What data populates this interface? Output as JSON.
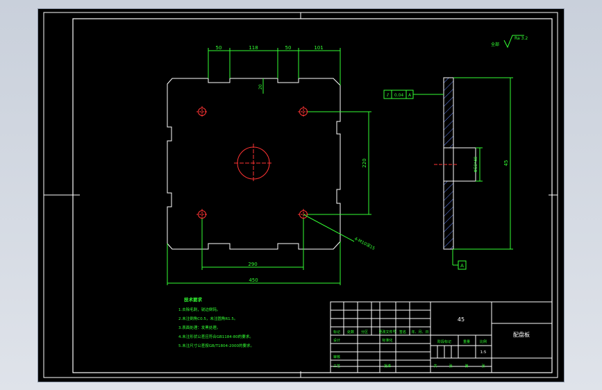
{
  "drawing": {
    "part_name": "配盘板",
    "material": "45",
    "scale": "1:5",
    "roughness_prefix": "全部",
    "roughness_value": "Ra 3.2"
  },
  "dimensions": {
    "top_widths": [
      "50",
      "118",
      "50",
      "101"
    ],
    "notch_depth": "20",
    "hole_spacing_vertical": "220",
    "hole_spacing_horizontal": "290",
    "overall_width": "450",
    "hole_callout": "4-M10深15",
    "section_height": "45",
    "section_bore": "Φ50*40"
  },
  "tolerance_frame": {
    "symbol": "⫽",
    "value": "0.04",
    "datum": "A"
  },
  "datum_label": "A",
  "tech_notes": {
    "title": "技术要求",
    "items": [
      "1.去除毛刺，锐边倒钝。",
      "2.未注倒角C0.5，未注圆角R1.5。",
      "3.表面处理：发黑处理。",
      "4.未注形状公差应符合GB1184-80的要求。",
      "5.未注尺寸公差按GB/T1804-2000的要求。"
    ]
  },
  "title_block": {
    "row1": [
      "标记",
      "处数",
      "分区",
      "更改文件号",
      "签名",
      "年、月、日"
    ],
    "row2_left": "设计",
    "row2_mid": "标准化",
    "row2_right": [
      "阶段标记",
      "重量",
      "比例"
    ],
    "row3_left": "审核",
    "row4_left": "工艺",
    "row4_mid": "批准",
    "row4_right": [
      "共",
      "张",
      "第",
      "张"
    ]
  }
}
